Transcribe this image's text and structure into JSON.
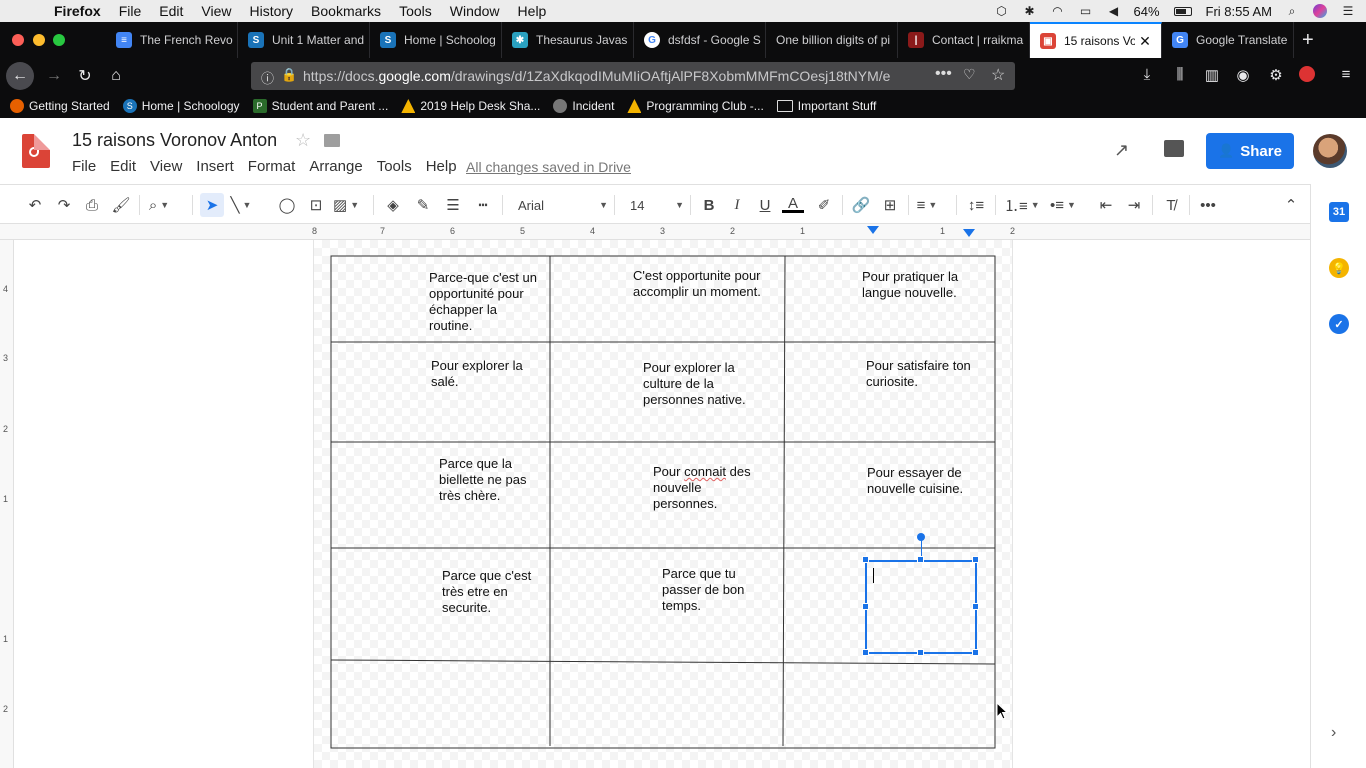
{
  "macos": {
    "app": "Firefox",
    "menus": [
      "File",
      "Edit",
      "View",
      "History",
      "Bookmarks",
      "Tools",
      "Window",
      "Help"
    ],
    "battery": "64%",
    "clock": "Fri 8:55 AM"
  },
  "browser": {
    "tabs": [
      {
        "title": "The French Revo",
        "color": "#4285f4",
        "glyph": "≡"
      },
      {
        "title": "Unit 1 Matter and",
        "color": "#1a73b8",
        "glyph": "S"
      },
      {
        "title": "Home | Schoolog",
        "color": "#1a73b8",
        "glyph": "S"
      },
      {
        "title": "Thesaurus Javas",
        "color": "#2aa1c0",
        "glyph": "✱"
      },
      {
        "title": "dsfdsf - Google S",
        "color": "#ffffff",
        "glyph": "G"
      },
      {
        "title": "One billion digits of pi",
        "color": "",
        "glyph": ""
      },
      {
        "title": "Contact | rraikma",
        "color": "#8b1a1a",
        "glyph": "|"
      },
      {
        "title": "15 raisons Voro",
        "color": "#db4437",
        "glyph": "▣"
      },
      {
        "title": "Google Translate",
        "color": "#4285f4",
        "glyph": "G"
      }
    ],
    "url_prefix": "https://docs.",
    "url_domain": "google.com",
    "url_rest": "/drawings/d/1ZaXdkqodIMuMIiOAftjAlPF8XobmMMFmCOesj18tNYM/e",
    "bookmarks": [
      {
        "label": "Getting Started",
        "color": "#e66000"
      },
      {
        "label": "Home | Schoology",
        "color": "#1a73b8"
      },
      {
        "label": "Student and Parent ...",
        "color": "#2b6b2b"
      },
      {
        "label": "2019 Help Desk Sha...",
        "color": "#f4b400"
      },
      {
        "label": "Incident",
        "color": "#777777"
      },
      {
        "label": "Programming Club -...",
        "color": "#f4b400"
      },
      {
        "label": "Important Stuff",
        "color": ""
      }
    ]
  },
  "doc": {
    "title": "15 raisons Voronov Anton",
    "menus": [
      "File",
      "Edit",
      "View",
      "Insert",
      "Format",
      "Arrange",
      "Tools",
      "Help"
    ],
    "saved_status": "All changes saved in Drive",
    "share_label": "Share"
  },
  "toolbar": {
    "font": "Arial",
    "font_size": "14"
  },
  "rulers": {
    "top": [
      "8",
      "7",
      "6",
      "5",
      "4",
      "3",
      "2",
      "1",
      "1",
      "2"
    ],
    "left": [
      "4",
      "3",
      "2",
      "1",
      "1",
      "2"
    ]
  },
  "cells": [
    {
      "text": "Parce-que c'est un\nopportunité pour\néchapper la\nroutine."
    },
    {
      "text": "C'est opportunite pour\naccomplir un moment."
    },
    {
      "text": "Pour pratiquer la\nlangue nouvelle."
    },
    {
      "text": "Pour explorer la\nsalé."
    },
    {
      "text": "Pour explorer la\nculture de la\npersonnes native."
    },
    {
      "text": "Pour satisfaire ton\ncuriosite."
    },
    {
      "text": "Parce que la\nbiellette ne pas\ntrès chère."
    },
    {
      "text_a": "Pour ",
      "text_b": "connait",
      "text_c": " des\nnouvelle\npersonnes."
    },
    {
      "text": "Pour essayer de\nnouvelle cuisine."
    },
    {
      "text": "Parce que c'est\ntrès etre en\nsecurite."
    },
    {
      "text": "Parce que tu\npasser de bon\ntemps."
    }
  ]
}
